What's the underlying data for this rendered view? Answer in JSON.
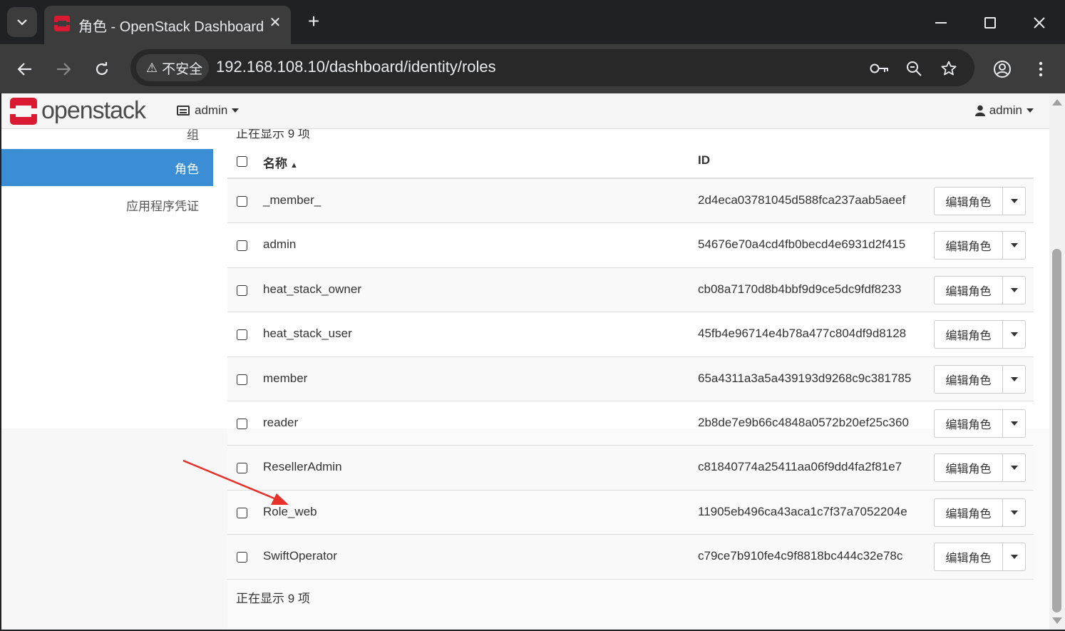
{
  "browser": {
    "tab_title": "角色 - OpenStack Dashboard",
    "security_label": "不安全",
    "url": "192.168.108.10/dashboard/identity/roles"
  },
  "header": {
    "logo_text": "openstack",
    "project_label": "admin",
    "user_label": "admin"
  },
  "sidebar": {
    "partial_item": "组",
    "items": [
      {
        "label": "角色",
        "active": true
      },
      {
        "label": "应用程序凭证",
        "active": false
      }
    ]
  },
  "table": {
    "count_text_top": "正在显示 9 项",
    "count_text_bottom": "正在显示 9 项",
    "headers": {
      "name": "名称",
      "id": "ID"
    },
    "action_label": "编辑角色",
    "rows": [
      {
        "name": "_member_",
        "id": "2d4eca03781045d588fca237aab5aeef"
      },
      {
        "name": "admin",
        "id": "54676e70a4cd4fb0becd4e6931d2f415"
      },
      {
        "name": "heat_stack_owner",
        "id": "cb08a7170d8b4bbf9d9ce5dc9fdf8233"
      },
      {
        "name": "heat_stack_user",
        "id": "45fb4e96714e4b78a477c804df9d8128"
      },
      {
        "name": "member",
        "id": "65a4311a3a5a439193d9268c9c381785"
      },
      {
        "name": "reader",
        "id": "2b8de7e9b66c4848a0572b20ef25c360"
      },
      {
        "name": "ResellerAdmin",
        "id": "c81840774a25411aa06f9dd4fa2f81e7"
      },
      {
        "name": "Role_web",
        "id": "11905eb496ca43aca1c7f37a7052204e"
      },
      {
        "name": "SwiftOperator",
        "id": "c79ce7b910fe4c9f8818bc444c32e78c"
      }
    ]
  },
  "colors": {
    "accent": "#3b8ed4",
    "brand_red": "#da1a32",
    "annotation_arrow": "#e8302a"
  }
}
